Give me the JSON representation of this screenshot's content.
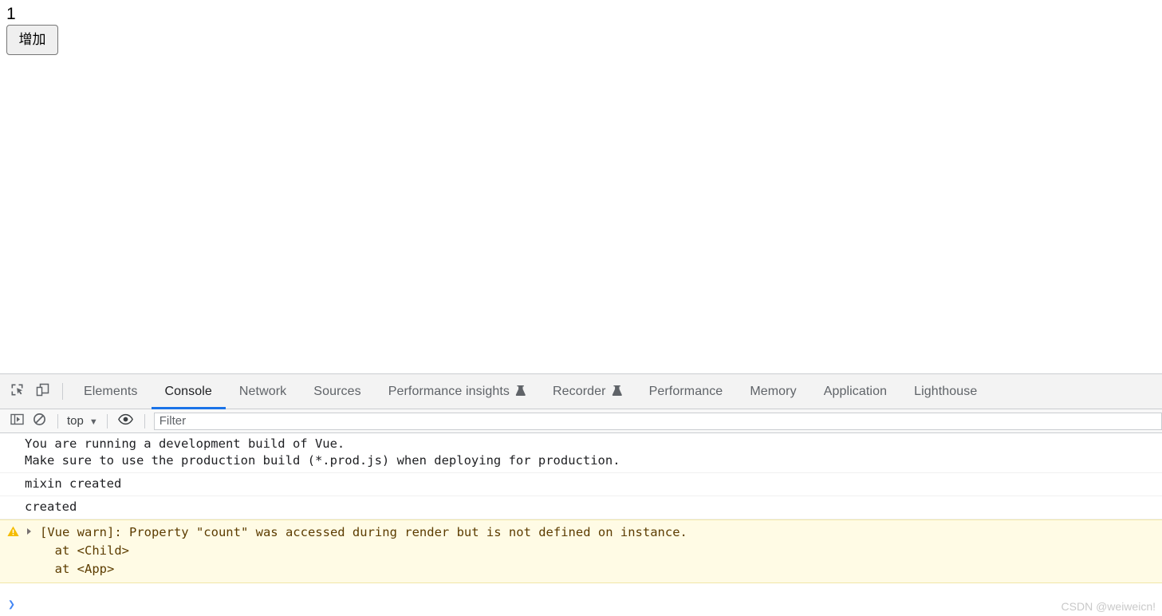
{
  "page": {
    "counter_value": "1",
    "increment_button_label": "增加"
  },
  "devtools": {
    "toolbar_icons": [
      {
        "name": "inspect-element-icon",
        "title": "Inspect element"
      },
      {
        "name": "device-toolbar-icon",
        "title": "Toggle device toolbar"
      }
    ],
    "tabs": [
      {
        "label": "Elements",
        "selected": false,
        "experimental": false
      },
      {
        "label": "Console",
        "selected": true,
        "experimental": false
      },
      {
        "label": "Network",
        "selected": false,
        "experimental": false
      },
      {
        "label": "Sources",
        "selected": false,
        "experimental": false
      },
      {
        "label": "Performance insights",
        "selected": false,
        "experimental": true
      },
      {
        "label": "Recorder",
        "selected": false,
        "experimental": true
      },
      {
        "label": "Performance",
        "selected": false,
        "experimental": false
      },
      {
        "label": "Memory",
        "selected": false,
        "experimental": false
      },
      {
        "label": "Application",
        "selected": false,
        "experimental": false
      },
      {
        "label": "Lighthouse",
        "selected": false,
        "experimental": false
      }
    ],
    "console_toolbar": {
      "sidebar_toggle_icon": "console-sidebar-icon",
      "clear_console_icon": "clear-console-icon",
      "context_selector_value": "top",
      "eye_icon": "live-expression-icon",
      "filter_placeholder": "Filter",
      "filter_value": ""
    },
    "messages": [
      {
        "level": "log",
        "text": "You are running a development build of Vue.\nMake sure to use the production build (*.prod.js) when deploying for production."
      },
      {
        "level": "log",
        "text": "mixin created"
      },
      {
        "level": "log",
        "text": "created"
      },
      {
        "level": "warning",
        "expandable": true,
        "text": "[Vue warn]: Property \"count\" was accessed during render but is not defined on instance.\n  at <Child>\n  at <App>"
      }
    ],
    "prompt": {
      "chevron": "›",
      "value": ""
    }
  },
  "watermark": {
    "text": "CSDN @weiweicn!"
  },
  "colors": {
    "accent_blue": "#1a73e8",
    "warning_bg": "#fffbe5",
    "warning_border": "#f0e6a8",
    "warning_text": "#5c3c00",
    "toolbar_bg": "#f3f3f3",
    "prompt_blue": "#4285f4"
  }
}
